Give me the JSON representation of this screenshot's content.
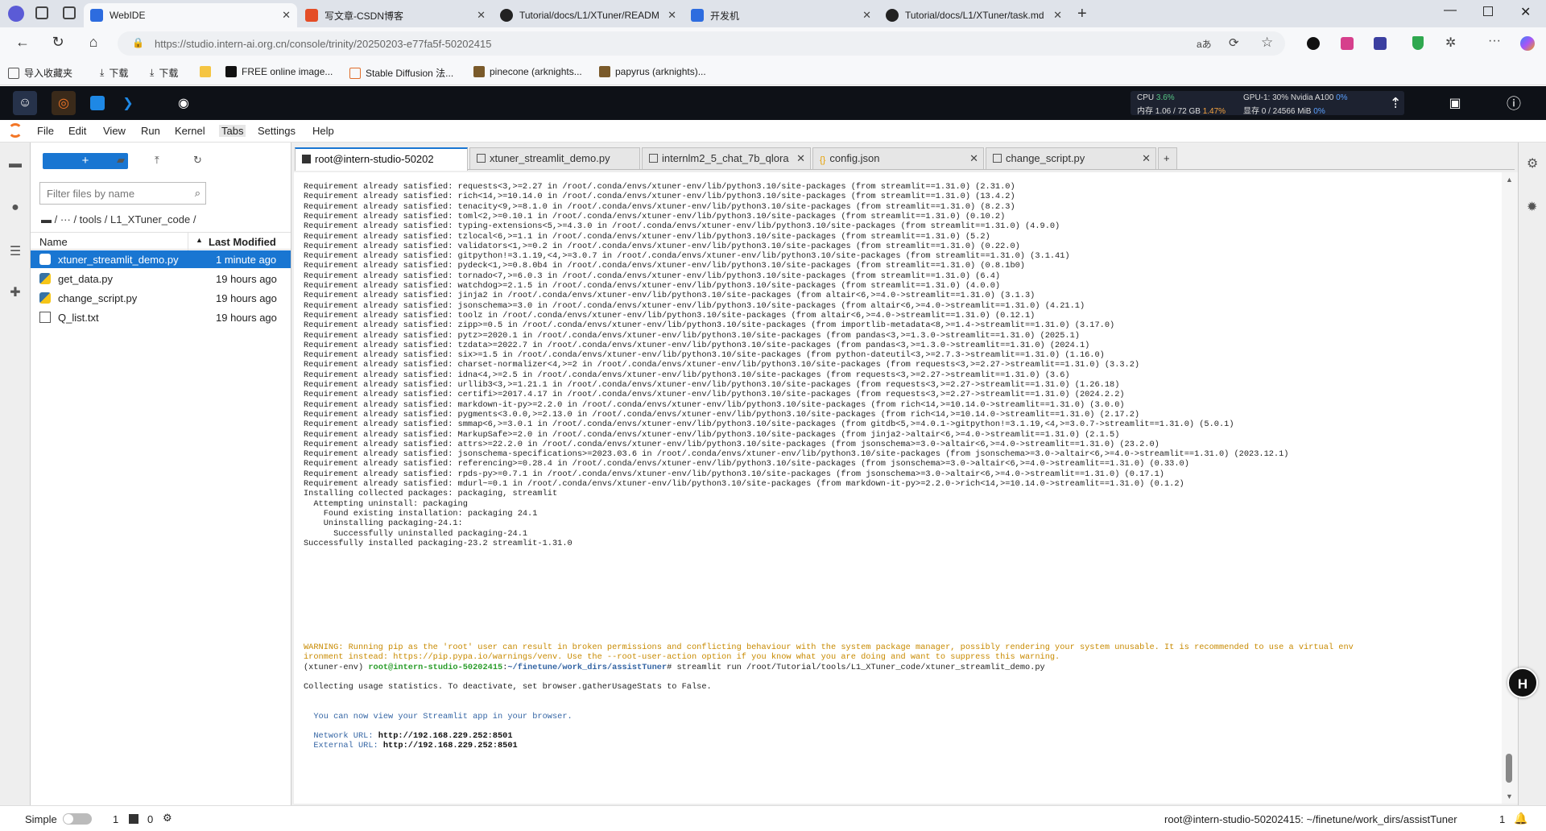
{
  "browser": {
    "tabs": [
      {
        "label": "WebIDE",
        "color": "#2d6cdf"
      },
      {
        "label": "写文章-CSDN博客",
        "color": "#e44d26"
      },
      {
        "label": "Tutorial/docs/L1/XTuner/READM",
        "color": "#222222"
      },
      {
        "label": "开发机",
        "color": "#2d6cdf"
      },
      {
        "label": "Tutorial/docs/L1/XTuner/task.md",
        "color": "#222222"
      }
    ],
    "url_host": "https://studio.intern-ai.org.cn",
    "url_path": "/console/trinity/20250203-e77fa5f-50202415",
    "bookmarks": [
      "导入收藏夹",
      "下载",
      "下载",
      "FREE online image...",
      "Stable Diffusion 法...",
      "pinecone (arknights...",
      "papyrus (arknights)..."
    ]
  },
  "ide_header": {
    "cpu_label": "CPU",
    "cpu_value": "3.6%",
    "mem_label": "内存 1.06 / 72 GB",
    "mem_value": "1.47%",
    "gpu_label": "GPU-1: 30% Nvidia A100",
    "gpu_value": "0%",
    "vram_label": "显存 0 / 24566 MiB",
    "vram_value": "0%"
  },
  "menu": [
    "File",
    "Edit",
    "View",
    "Run",
    "Kernel",
    "Tabs",
    "Settings",
    "Help"
  ],
  "file_browser": {
    "new_label": "+",
    "filter_placeholder": "Filter files by name",
    "breadcrumb": "/   ···   /  tools  /  L1_XTuner_code  /",
    "col_name": "Name",
    "col_modified": "Last Modified",
    "files": [
      {
        "name": "xtuner_streamlit_demo.py",
        "modified": "1 minute ago"
      },
      {
        "name": "get_data.py",
        "modified": "19 hours ago"
      },
      {
        "name": "change_script.py",
        "modified": "19 hours ago"
      },
      {
        "name": "Q_list.txt",
        "modified": "19 hours ago"
      }
    ]
  },
  "doc_tabs": [
    {
      "label": "root@intern-studio-50202"
    },
    {
      "label": "xtuner_streamlit_demo.py"
    },
    {
      "label": "internlm2_5_chat_7b_qlora"
    },
    {
      "label": "config.json"
    },
    {
      "label": "change_script.py"
    }
  ],
  "terminal": {
    "lines": [
      "Requirement already satisfied: requests<3,>=2.27 in /root/.conda/envs/xtuner-env/lib/python3.10/site-packages (from streamlit==1.31.0) (2.31.0)",
      "Requirement already satisfied: rich<14,>=10.14.0 in /root/.conda/envs/xtuner-env/lib/python3.10/site-packages (from streamlit==1.31.0) (13.4.2)",
      "Requirement already satisfied: tenacity<9,>=8.1.0 in /root/.conda/envs/xtuner-env/lib/python3.10/site-packages (from streamlit==1.31.0) (8.2.3)",
      "Requirement already satisfied: toml<2,>=0.10.1 in /root/.conda/envs/xtuner-env/lib/python3.10/site-packages (from streamlit==1.31.0) (0.10.2)",
      "Requirement already satisfied: typing-extensions<5,>=4.3.0 in /root/.conda/envs/xtuner-env/lib/python3.10/site-packages (from streamlit==1.31.0) (4.9.0)",
      "Requirement already satisfied: tzlocal<6,>=1.1 in /root/.conda/envs/xtuner-env/lib/python3.10/site-packages (from streamlit==1.31.0) (5.2)",
      "Requirement already satisfied: validators<1,>=0.2 in /root/.conda/envs/xtuner-env/lib/python3.10/site-packages (from streamlit==1.31.0) (0.22.0)",
      "Requirement already satisfied: gitpython!=3.1.19,<4,>=3.0.7 in /root/.conda/envs/xtuner-env/lib/python3.10/site-packages (from streamlit==1.31.0) (3.1.41)",
      "Requirement already satisfied: pydeck<1,>=0.8.0b4 in /root/.conda/envs/xtuner-env/lib/python3.10/site-packages (from streamlit==1.31.0) (0.8.1b0)",
      "Requirement already satisfied: tornado<7,>=6.0.3 in /root/.conda/envs/xtuner-env/lib/python3.10/site-packages (from streamlit==1.31.0) (6.4)",
      "Requirement already satisfied: watchdog>=2.1.5 in /root/.conda/envs/xtuner-env/lib/python3.10/site-packages (from streamlit==1.31.0) (4.0.0)",
      "Requirement already satisfied: jinja2 in /root/.conda/envs/xtuner-env/lib/python3.10/site-packages (from altair<6,>=4.0->streamlit==1.31.0) (3.1.3)",
      "Requirement already satisfied: jsonschema>=3.0 in /root/.conda/envs/xtuner-env/lib/python3.10/site-packages (from altair<6,>=4.0->streamlit==1.31.0) (4.21.1)",
      "Requirement already satisfied: toolz in /root/.conda/envs/xtuner-env/lib/python3.10/site-packages (from altair<6,>=4.0->streamlit==1.31.0) (0.12.1)",
      "Requirement already satisfied: zipp>=0.5 in /root/.conda/envs/xtuner-env/lib/python3.10/site-packages (from importlib-metadata<8,>=1.4->streamlit==1.31.0) (3.17.0)",
      "Requirement already satisfied: pytz>=2020.1 in /root/.conda/envs/xtuner-env/lib/python3.10/site-packages (from pandas<3,>=1.3.0->streamlit==1.31.0) (2025.1)",
      "Requirement already satisfied: tzdata>=2022.7 in /root/.conda/envs/xtuner-env/lib/python3.10/site-packages (from pandas<3,>=1.3.0->streamlit==1.31.0) (2024.1)",
      "Requirement already satisfied: six>=1.5 in /root/.conda/envs/xtuner-env/lib/python3.10/site-packages (from python-dateutil<3,>=2.7.3->streamlit==1.31.0) (1.16.0)",
      "Requirement already satisfied: charset-normalizer<4,>=2 in /root/.conda/envs/xtuner-env/lib/python3.10/site-packages (from requests<3,>=2.27->streamlit==1.31.0) (3.3.2)",
      "Requirement already satisfied: idna<4,>=2.5 in /root/.conda/envs/xtuner-env/lib/python3.10/site-packages (from requests<3,>=2.27->streamlit==1.31.0) (3.6)",
      "Requirement already satisfied: urllib3<3,>=1.21.1 in /root/.conda/envs/xtuner-env/lib/python3.10/site-packages (from requests<3,>=2.27->streamlit==1.31.0) (1.26.18)",
      "Requirement already satisfied: certifi>=2017.4.17 in /root/.conda/envs/xtuner-env/lib/python3.10/site-packages (from requests<3,>=2.27->streamlit==1.31.0) (2024.2.2)",
      "Requirement already satisfied: markdown-it-py>=2.2.0 in /root/.conda/envs/xtuner-env/lib/python3.10/site-packages (from rich<14,>=10.14.0->streamlit==1.31.0) (3.0.0)",
      "Requirement already satisfied: pygments<3.0.0,>=2.13.0 in /root/.conda/envs/xtuner-env/lib/python3.10/site-packages (from rich<14,>=10.14.0->streamlit==1.31.0) (2.17.2)",
      "Requirement already satisfied: smmap<6,>=3.0.1 in /root/.conda/envs/xtuner-env/lib/python3.10/site-packages (from gitdb<5,>=4.0.1->gitpython!=3.1.19,<4,>=3.0.7->streamlit==1.31.0) (5.0.1)",
      "Requirement already satisfied: MarkupSafe>=2.0 in /root/.conda/envs/xtuner-env/lib/python3.10/site-packages (from jinja2->altair<6,>=4.0->streamlit==1.31.0) (2.1.5)",
      "Requirement already satisfied: attrs>=22.2.0 in /root/.conda/envs/xtuner-env/lib/python3.10/site-packages (from jsonschema>=3.0->altair<6,>=4.0->streamlit==1.31.0) (23.2.0)",
      "Requirement already satisfied: jsonschema-specifications>=2023.03.6 in /root/.conda/envs/xtuner-env/lib/python3.10/site-packages (from jsonschema>=3.0->altair<6,>=4.0->streamlit==1.31.0) (2023.12.1)",
      "Requirement already satisfied: referencing>=0.28.4 in /root/.conda/envs/xtuner-env/lib/python3.10/site-packages (from jsonschema>=3.0->altair<6,>=4.0->streamlit==1.31.0) (0.33.0)",
      "Requirement already satisfied: rpds-py>=0.7.1 in /root/.conda/envs/xtuner-env/lib/python3.10/site-packages (from jsonschema>=3.0->altair<6,>=4.0->streamlit==1.31.0) (0.17.1)",
      "Requirement already satisfied: mdurl~=0.1 in /root/.conda/envs/xtuner-env/lib/python3.10/site-packages (from markdown-it-py>=2.2.0->rich<14,>=10.14.0->streamlit==1.31.0) (0.1.2)",
      "Installing collected packages: packaging, streamlit",
      "  Attempting uninstall: packaging",
      "    Found existing installation: packaging 24.1",
      "    Uninstalling packaging-24.1:",
      "      Successfully uninstalled packaging-24.1",
      "Successfully installed packaging-23.2 streamlit-1.31.0"
    ],
    "warning_1": "WARNING: Running pip as the 'root' user can result in broken permissions and conflicting behaviour with the system package manager, possibly rendering your system unusable. It is recommended to use a virtual env",
    "warning_2": "ironment instead: https://pip.pypa.io/warnings/venv. Use the --root-user-action option if you know what you are doing and want to suppress this warning.",
    "prompt_env": "(xtuner-env) ",
    "prompt_host": "root@intern-studio-50202415",
    "prompt_path": "~/finetune/work_dirs/assistTuner",
    "prompt_cmd": "# streamlit run /root/Tutorial/tools/L1_XTuner_code/xtuner_streamlit_demo.py",
    "collecting": "Collecting usage statistics. To deactivate, set browser.gatherUsageStats to False.",
    "view_msg": "  You can now view your Streamlit app in your browser.",
    "network_label": "  Network URL: ",
    "network_url": "http://192.168.229.252:8501",
    "external_label": "  External URL: ",
    "external_url": "http://192.168.229.252:8501"
  },
  "status_bar": {
    "mode": "Simple",
    "count1": "1",
    "count2": "0",
    "right_text": "root@intern-studio-50202415: ~/finetune/work_dirs/assistTuner",
    "right_num": "1"
  },
  "badge": "H"
}
